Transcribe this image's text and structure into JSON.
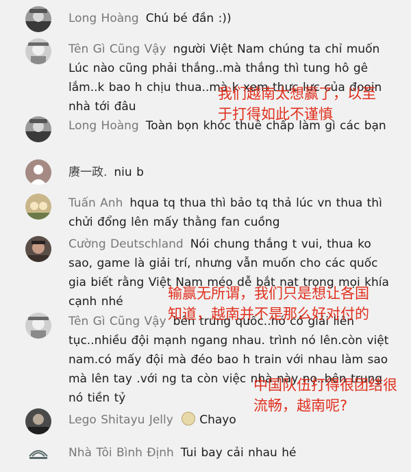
{
  "comments": [
    {
      "author": "Long Hoàng",
      "text": "Chú bé đần :))"
    },
    {
      "author": "Tên Gì Cũng Vậy",
      "text": "người Việt Nam chúng ta chỉ muốn Lúc nào cũng phải thắng..mà thắng thì tung hô gê lắm..k bao h chịu thua..mà k xem thực lực của đooin nhà tới đâu"
    },
    {
      "author": "Long Hoàng",
      "text": "Toàn bọn khóc thuê chấp làm gì các bạn"
    },
    {
      "author": "赓一政.",
      "text": "niu b"
    },
    {
      "author": "Tuấn Anh",
      "text": "hqua tq thua thì bảo tq thả lúc vn thua thì chửi đổng lên mấy thằng fan cuồng"
    },
    {
      "author": "Cường Deutschland",
      "text": "Nói chung thắng t vui, thua ko sao, game là giải trí, nhưng vẫn muốn cho các quốc gia biết rằng Việt Nam méo dễ bắt nạt trong mọi khía cạnh nhé"
    },
    {
      "author": "Tên Gì Cũng Vậy",
      "text": "bên trung quốc..nó có giải liên tục..nhiều đội mạnh ngang nhau. trình nó lên.còn việt nam.có mấy đội mà đéo bao h train với nhau làm sao mà lên tay .với ng ta còn việc nhà này nọ..bên trung nó tiền tỷ"
    },
    {
      "author": "Lego Shitayu Jelly",
      "text": "Chayo"
    },
    {
      "author": "Nhà Tôi Bình Định",
      "text": "Tui bay cải nhau hé"
    }
  ],
  "overlays": {
    "note1_line1": "我们越南太想赢了，以至",
    "note1_line2": "于打得如此不谨慎",
    "note2_line1": "输赢无所谓，我们只是想让各国",
    "note2_line2": "知道，越南并不是那么好对付的",
    "note3_line1": "中国队伍打得很团结很",
    "note3_line2": "流畅，越南呢?"
  },
  "icons": {
    "author_emoji": "cat-face-icon"
  },
  "colors": {
    "overlay_text": "#e0301e",
    "author": "#777777",
    "body_text": "#1c1c1c"
  }
}
